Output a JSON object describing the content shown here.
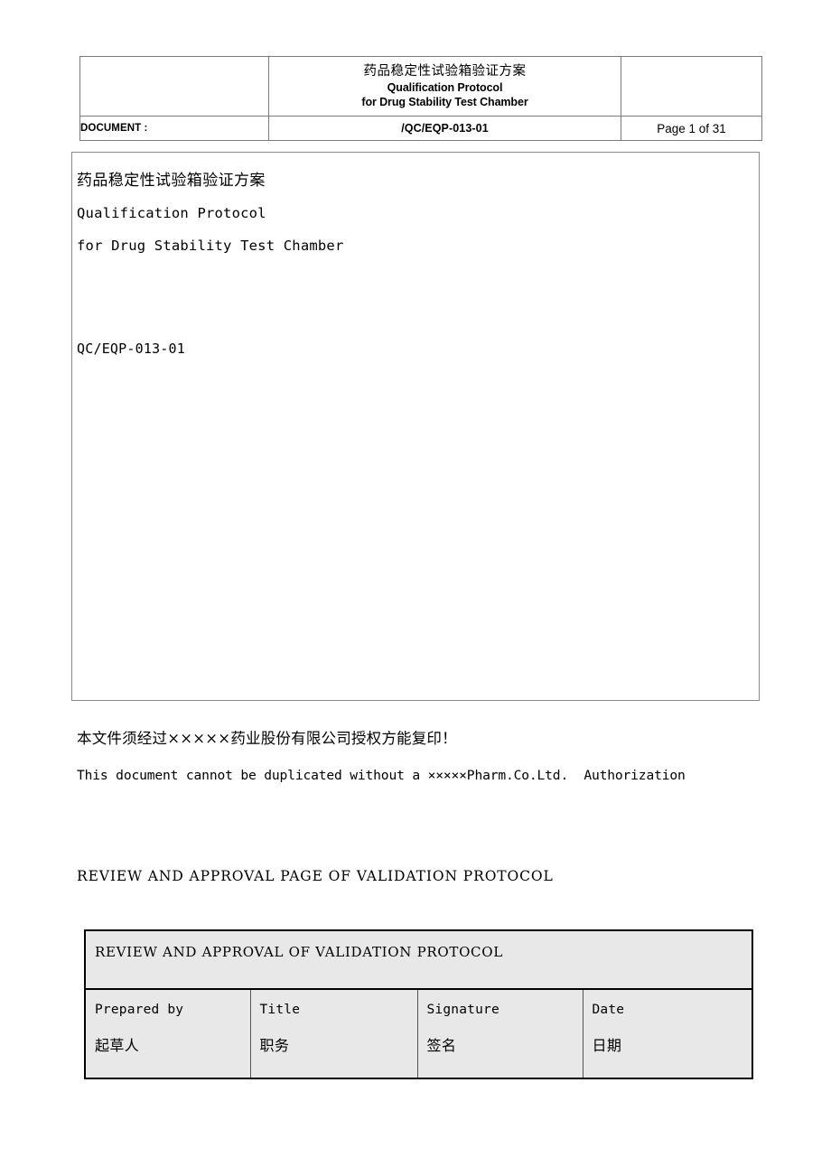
{
  "page_header": {
    "title_cn": "药品稳定性试验箱验证方案",
    "title_en_line1": "Qualification Protocol",
    "title_en_line2": "for Drug Stability Test Chamber",
    "document_label": "DOCUMENT :",
    "document_number": "/QC/EQP-013-01",
    "page_indicator": "Page 1 of 31",
    "blank_left": "",
    "blank_right": ""
  },
  "cover": {
    "line_cn": "药品稳定性试验箱验证方案",
    "line_en1": "Qualification Protocol",
    "line_en2": "for Drug Stability Test Chamber",
    "doc_code": "QC/EQP-013-01"
  },
  "copyright": {
    "chinese": "本文件须经过×××××药业股份有限公司授权方能复印！",
    "english": "This document cannot be duplicated without a ×××××Pharm.Co.Ltd.  Authorization"
  },
  "section": {
    "heading": "REVIEW AND APPROVAL PAGE OF VALIDATION PROTOCOL"
  },
  "approval_table": {
    "title": "REVIEW AND APPROVAL OF VALIDATION PROTOCOL",
    "columns": [
      {
        "en": "Prepared by",
        "cn": "起草人"
      },
      {
        "en": "Title",
        "cn": "职务"
      },
      {
        "en": "Signature",
        "cn": "签名"
      },
      {
        "en": "Date",
        "cn": "日期"
      }
    ]
  },
  "colors": {
    "table_fill": "#e8e8e8",
    "border_dark": "#000000",
    "border_light": "#7a7a7a",
    "text": "#000000",
    "page_background": "#ffffff"
  }
}
